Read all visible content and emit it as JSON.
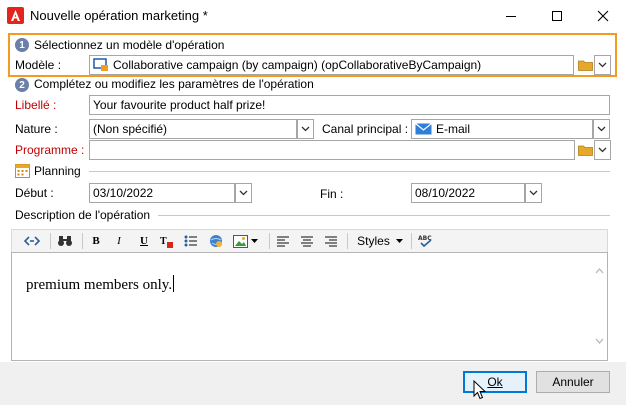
{
  "window": {
    "title": "Nouvelle opération marketing *"
  },
  "step1": {
    "badge": "1",
    "heading": "Sélectionnez un modèle d'opération",
    "model_label": "Modèle :",
    "model_value": "Collaborative campaign (by campaign) (opCollaborativeByCampaign)"
  },
  "step2": {
    "badge": "2",
    "heading": "Complétez ou modifiez les paramètres de l'opération"
  },
  "form": {
    "libelle_label": "Libellé :",
    "libelle_value": "Your favourite product half prize!",
    "nature_label": "Nature :",
    "nature_value": "(Non spécifié)",
    "canal_label": "Canal principal :",
    "canal_value": "E-mail",
    "programme_label": "Programme :",
    "programme_value": ""
  },
  "planning": {
    "heading": "Planning",
    "debut_label": "Début :",
    "debut_value": "03/10/2022",
    "fin_label": "Fin :",
    "fin_value": "08/10/2022"
  },
  "description": {
    "heading": "Description de l'opération",
    "toolbar": {
      "bold": "B",
      "italic": "I",
      "underline": "U",
      "styles": "Styles"
    },
    "content": "premium members only."
  },
  "footer": {
    "ok_label": "Ok",
    "cancel_label": "Annuler"
  },
  "colors": {
    "highlight_frame": "#f29b20",
    "required_label": "#c00000",
    "default_button": "#0078d7"
  }
}
